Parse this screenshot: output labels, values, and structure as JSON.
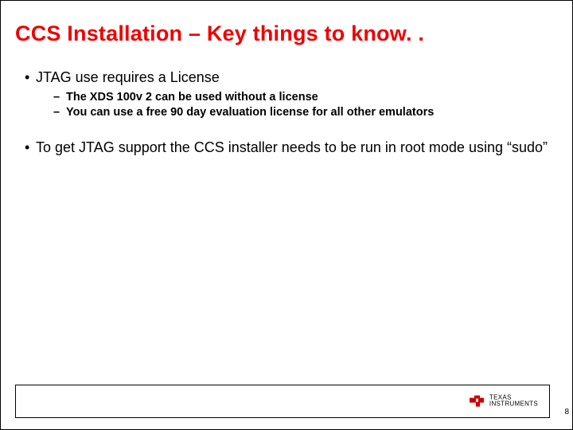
{
  "title": "CCS Installation – Key things to know. .",
  "bullets": {
    "b1": "JTAG use requires a License",
    "b1_subs": {
      "s1": "The XDS 100v 2 can be used without a license",
      "s2": "You can use a free 90 day evaluation license for all other emulators"
    },
    "b2": "To get JTAG support the CCS installer needs to be run in root mode using “sudo”"
  },
  "footer": {
    "logo_line1": "TEXAS",
    "logo_line2": "INSTRUMENTS"
  },
  "page_number": "8"
}
